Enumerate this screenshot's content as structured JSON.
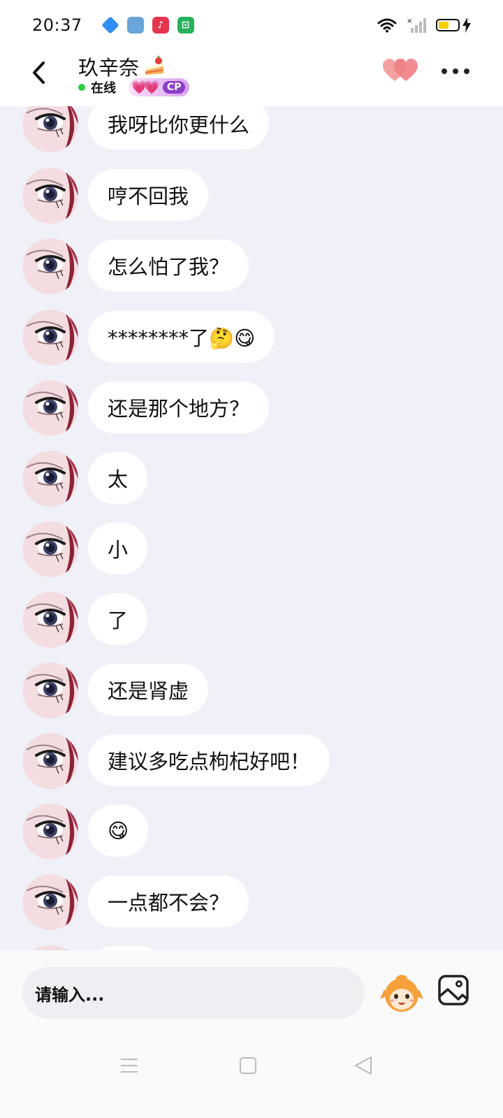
{
  "status_bar": {
    "time": "20:37"
  },
  "header": {
    "contact_name": "玖辛奈",
    "status": "在线",
    "badge_label": "CP"
  },
  "messages": [
    {
      "text": "我呀比你更什么"
    },
    {
      "text": "哼不回我"
    },
    {
      "text": "怎么怕了我？"
    },
    {
      "text": "********了🤔😋"
    },
    {
      "text": "还是那个地方？"
    },
    {
      "text": "太"
    },
    {
      "text": "小"
    },
    {
      "text": "了"
    },
    {
      "text": "还是肾虚"
    },
    {
      "text": "建议多吃点枸杞好吧！"
    },
    {
      "text": "😋"
    },
    {
      "text": "一点都不会？"
    }
  ],
  "input": {
    "placeholder": "请输入..."
  },
  "colors": {
    "background": "#f0f1f8",
    "bubble": "#ffffff",
    "online": "#2ecc40",
    "battery": "#f5d000",
    "heart": "#f08a8a",
    "badge": "#8a3fc7"
  },
  "icons": {
    "back": "chevron-left-icon",
    "cake": "cake-icon",
    "favorite": "double-heart-icon",
    "more": "more-dots-icon",
    "emoji": "mascot-emoji-icon",
    "image": "image-icon",
    "nav_menu": "menu-icon",
    "nav_home": "square-home-icon",
    "nav_back": "triangle-back-icon"
  }
}
